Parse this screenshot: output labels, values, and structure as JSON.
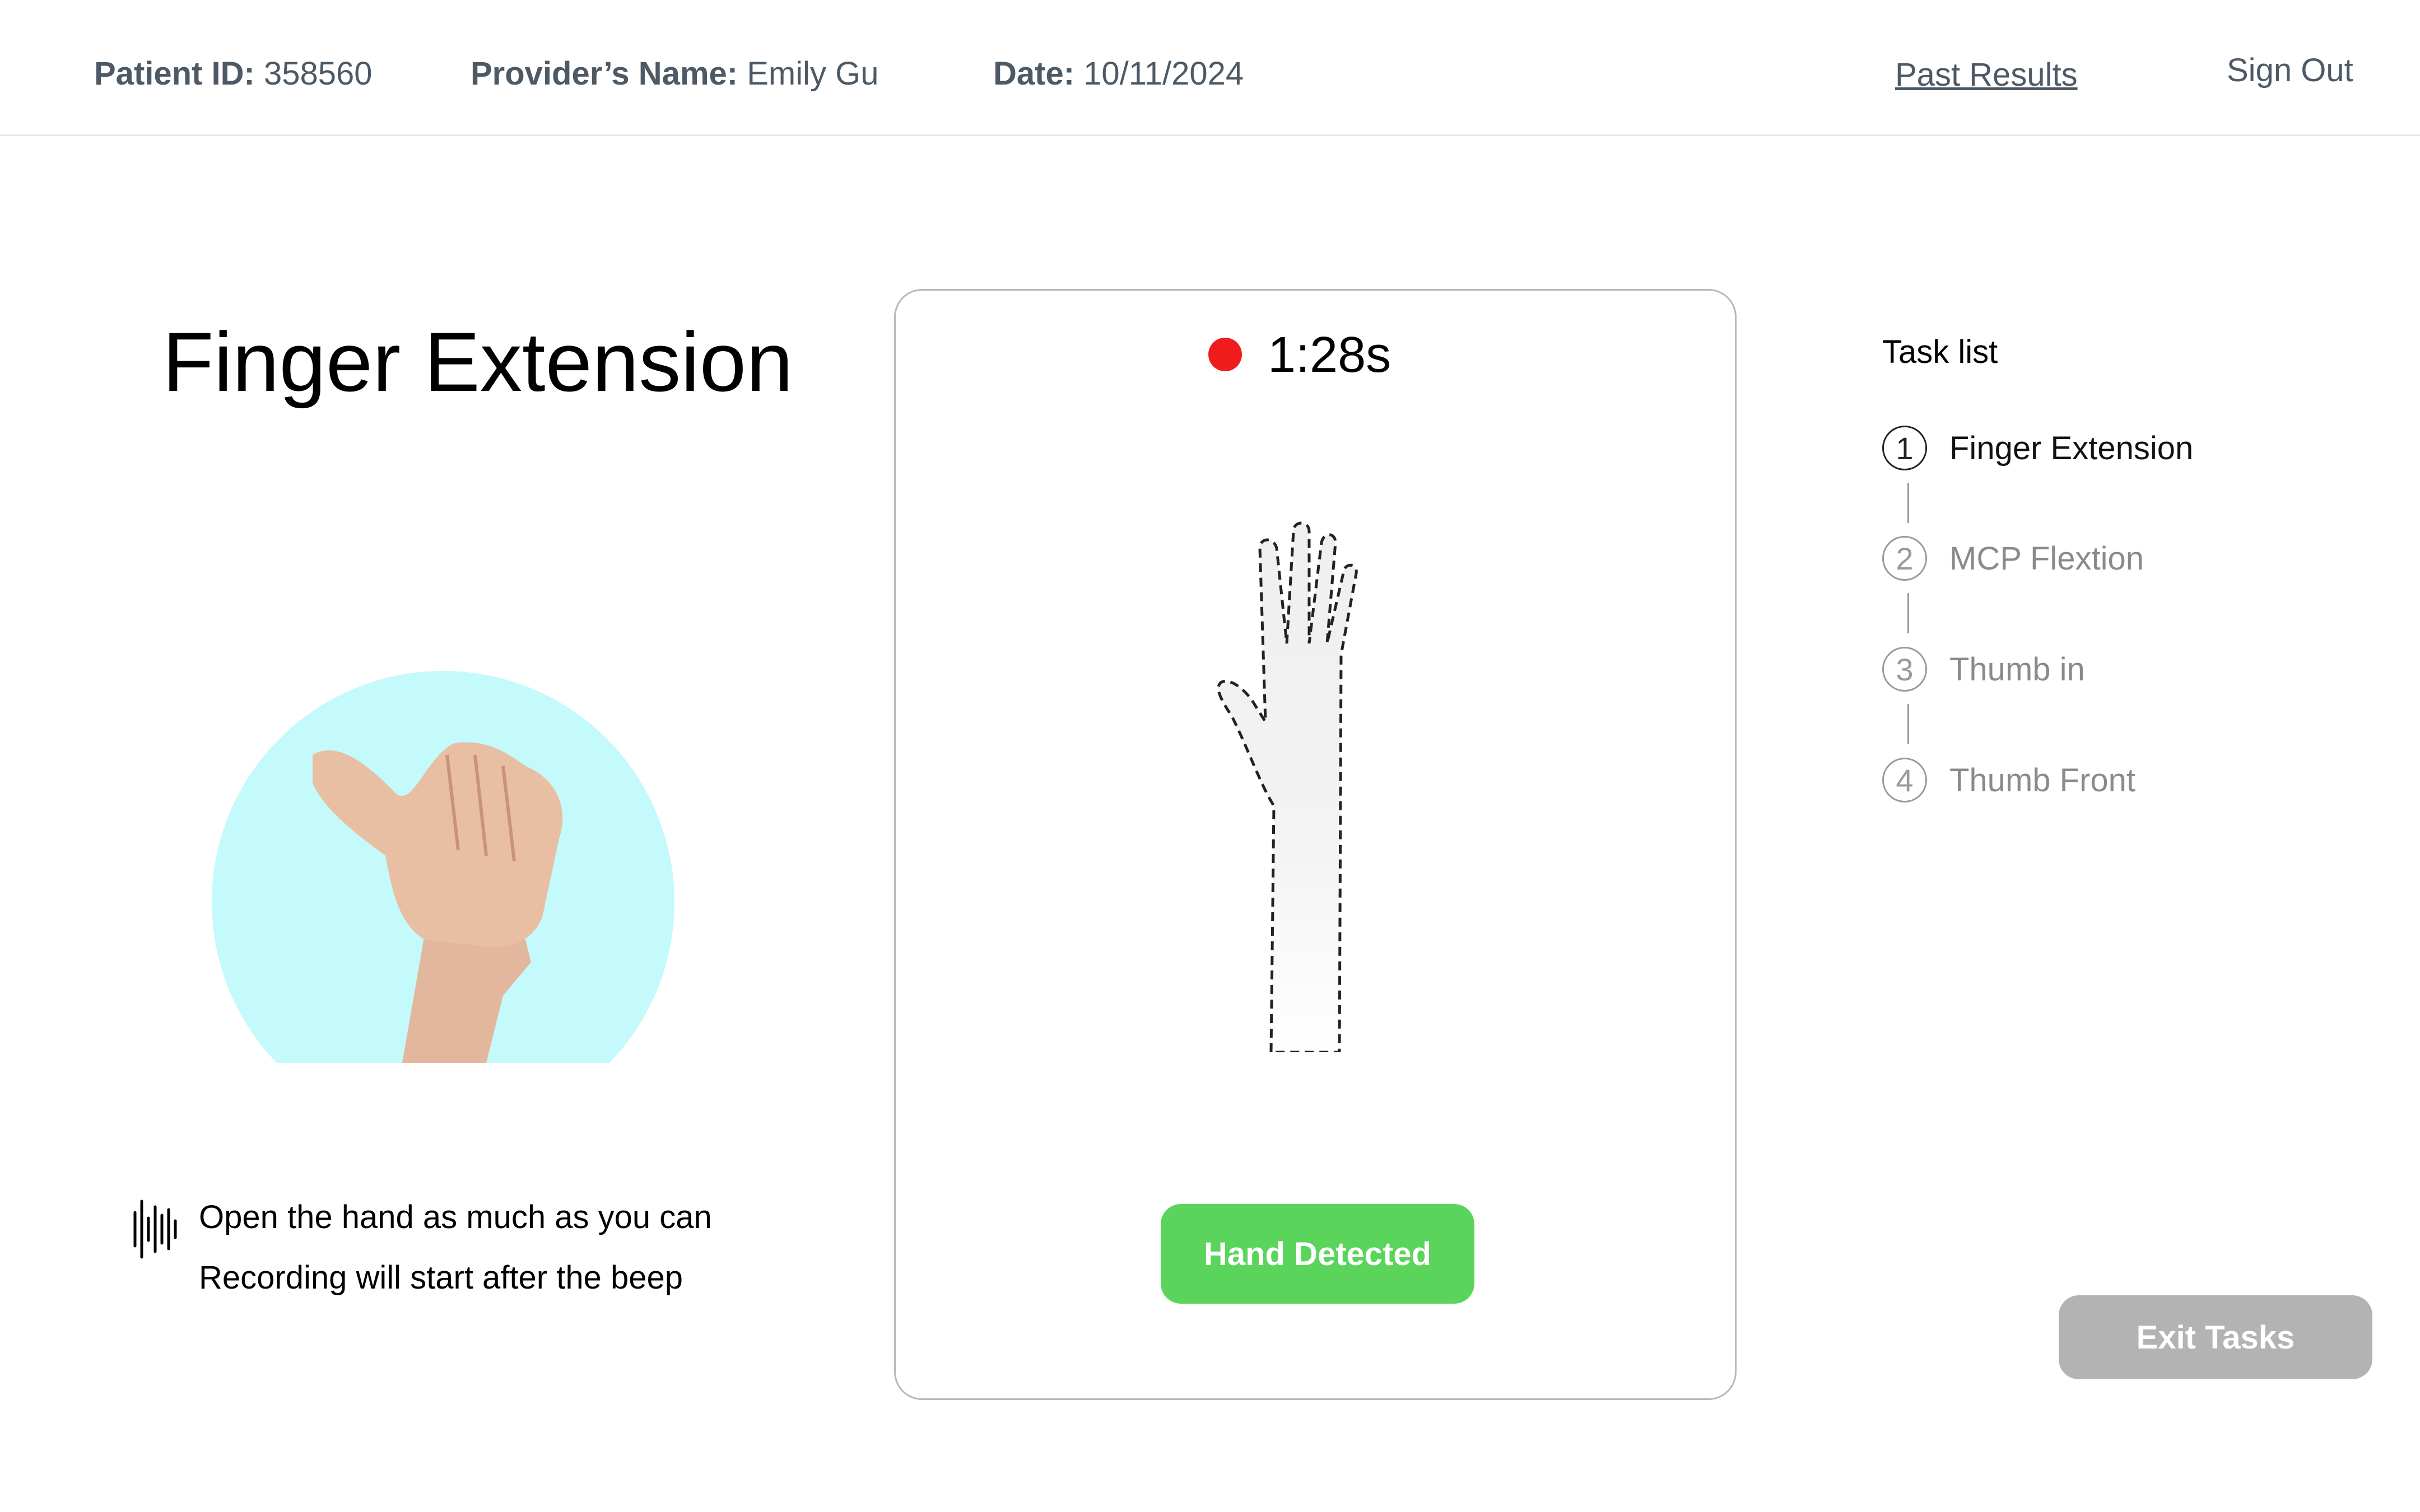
{
  "header": {
    "patient_id_label": "Patient ID:",
    "patient_id_value": "358560",
    "provider_label": "Provider’s Name:",
    "provider_value": "Emily Gu",
    "date_label": "Date:",
    "date_value": "10/11/2024",
    "past_results_label": "Past Results",
    "sign_out_label": "Sign Out"
  },
  "task": {
    "title": "Finger Extension",
    "instruction_line_1": "Open the hand as much as you can",
    "instruction_line_2": "Recording will start after the beep",
    "demo_icon": "thumbs-up-hand-image",
    "voice_icon": "sound-wave-icon"
  },
  "camera": {
    "timer": "1:28s",
    "status_button": "Hand Detected",
    "recording_indicator_color": "#ee1c1c",
    "status_color": "#5bd45b"
  },
  "task_list": {
    "heading": "Task list",
    "items": [
      {
        "number": "1",
        "label": "Finger Extension",
        "active": true
      },
      {
        "number": "2",
        "label": "MCP Flextion",
        "active": false
      },
      {
        "number": "3",
        "label": "Thumb in",
        "active": false
      },
      {
        "number": "4",
        "label": "Thumb Front",
        "active": false
      }
    ]
  },
  "actions": {
    "exit_label": "Exit Tasks"
  },
  "colors": {
    "accent_circle": "#c4fafc",
    "header_text": "#4d5a66",
    "exit_button": "#b3b3b3"
  }
}
